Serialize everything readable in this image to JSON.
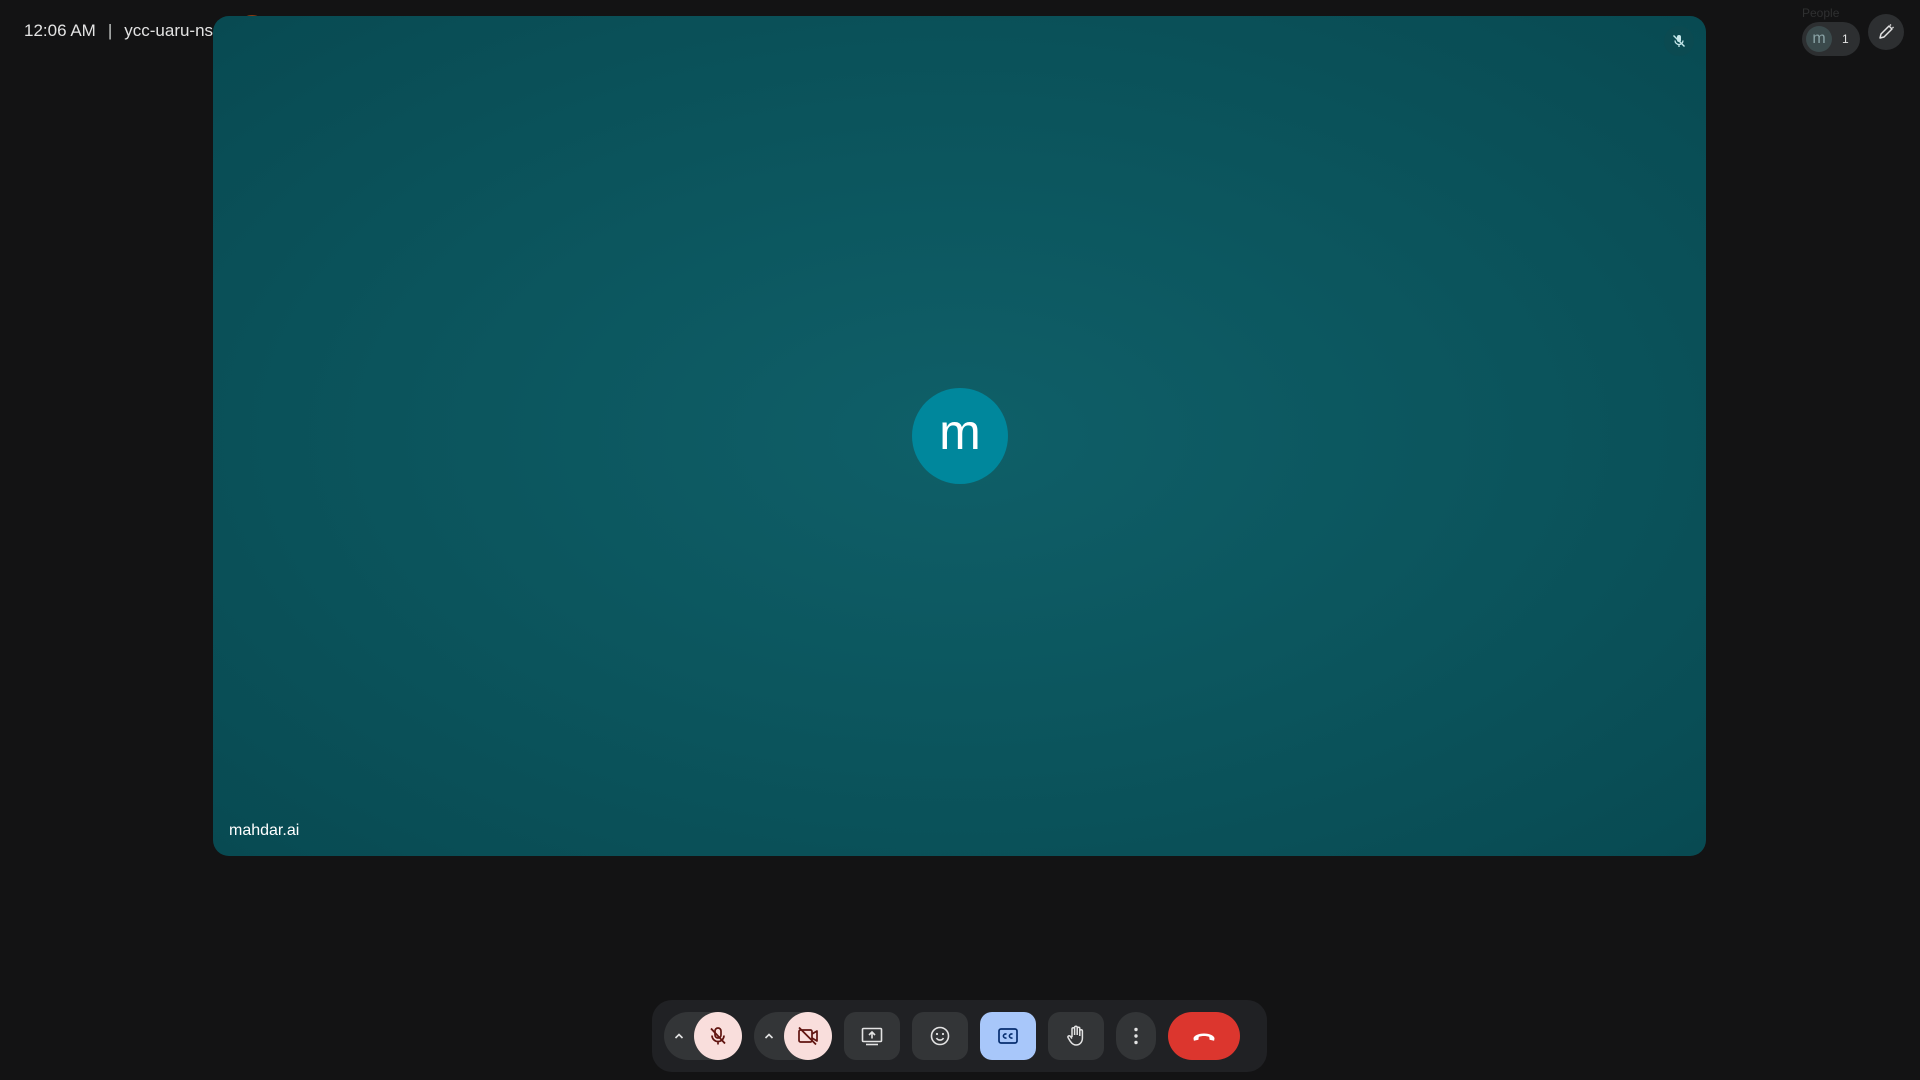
{
  "meeting": {
    "time": "12:06 AM",
    "separator": "|",
    "code": "ycc-uaru-nsm",
    "host_controls_icon": "door-icon",
    "info_icon": "info-icon"
  },
  "tile": {
    "avatar_letter": "m",
    "participant_name": "mahdar.ai",
    "muted_icon": "mic-off-icon",
    "background_color": "#0d5a62",
    "avatar_color": "#00879c"
  },
  "top_right": {
    "people_label": "People",
    "avatar_letter": "m",
    "participant_count": "1",
    "edit_icon": "edit-pen-icon"
  },
  "controls": {
    "audio_options_icon": "chevron-up-icon",
    "mic_icon": "mic-off-icon",
    "video_options_icon": "chevron-up-icon",
    "camera_icon": "videocam-off-icon",
    "present_icon": "present-screen-icon",
    "emoji_icon": "emoji-icon",
    "captions_icon": "closed-captions-icon",
    "hand_icon": "raise-hand-icon",
    "more_icon": "more-vert-icon",
    "hangup_icon": "call-end-icon",
    "accent_color": "#a8c7fa",
    "hangup_color": "#dc362e"
  }
}
